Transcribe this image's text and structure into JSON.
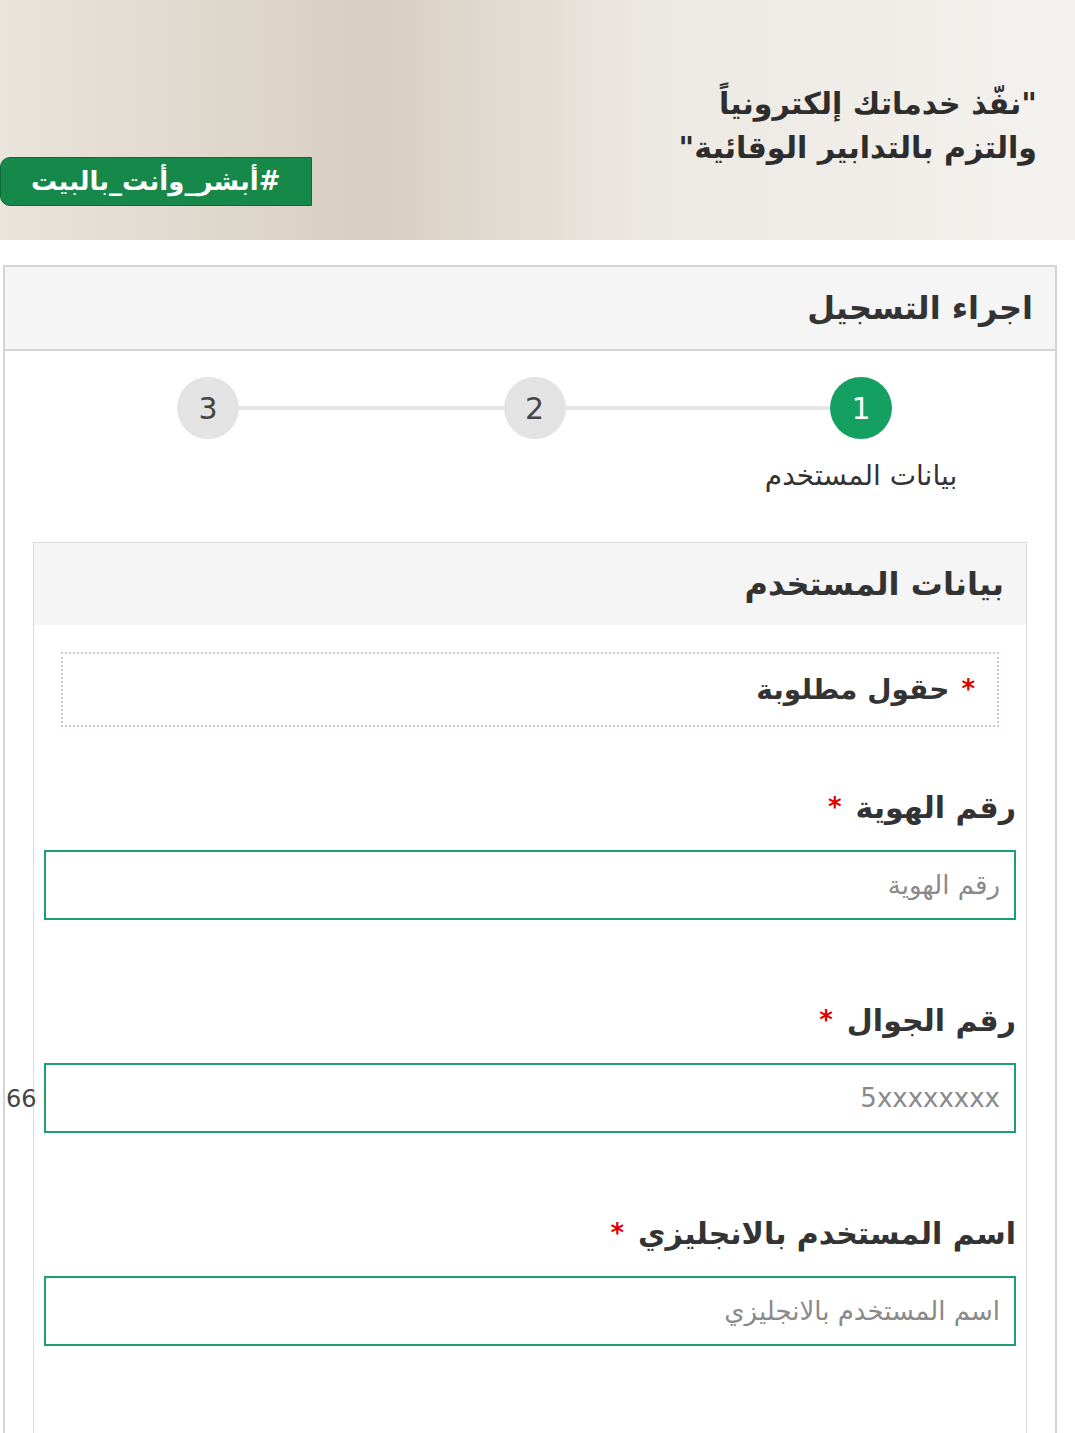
{
  "banner": {
    "headline": [
      "\"نفّذ خدماتك إلكترونياً",
      "والتزم بالتدابير الوقائية\""
    ],
    "hashtag": "#أبشر_وأنت_بالبيت"
  },
  "card": {
    "title": "اجراء التسجيل"
  },
  "steps": [
    {
      "number": "1",
      "label": "بيانات المستخدم",
      "selected": true
    },
    {
      "number": "2",
      "label": "",
      "selected": false
    },
    {
      "number": "3",
      "label": "",
      "selected": false
    }
  ],
  "section": {
    "title": "بيانات المستخدم"
  },
  "required_note": {
    "marker": "*",
    "text": "حقول مطلوبة"
  },
  "fields": [
    {
      "label": "رقم الهوية",
      "marker": "*",
      "placeholder": "رقم الهوية",
      "prefix": ""
    },
    {
      "label": "رقم الجوال",
      "marker": "*",
      "placeholder": "5xxxxxxxx",
      "prefix": "66"
    },
    {
      "label": "اسم المستخدم بالانجليزي",
      "marker": "*",
      "placeholder": "اسم المستخدم بالانجليزي",
      "prefix": ""
    }
  ]
}
